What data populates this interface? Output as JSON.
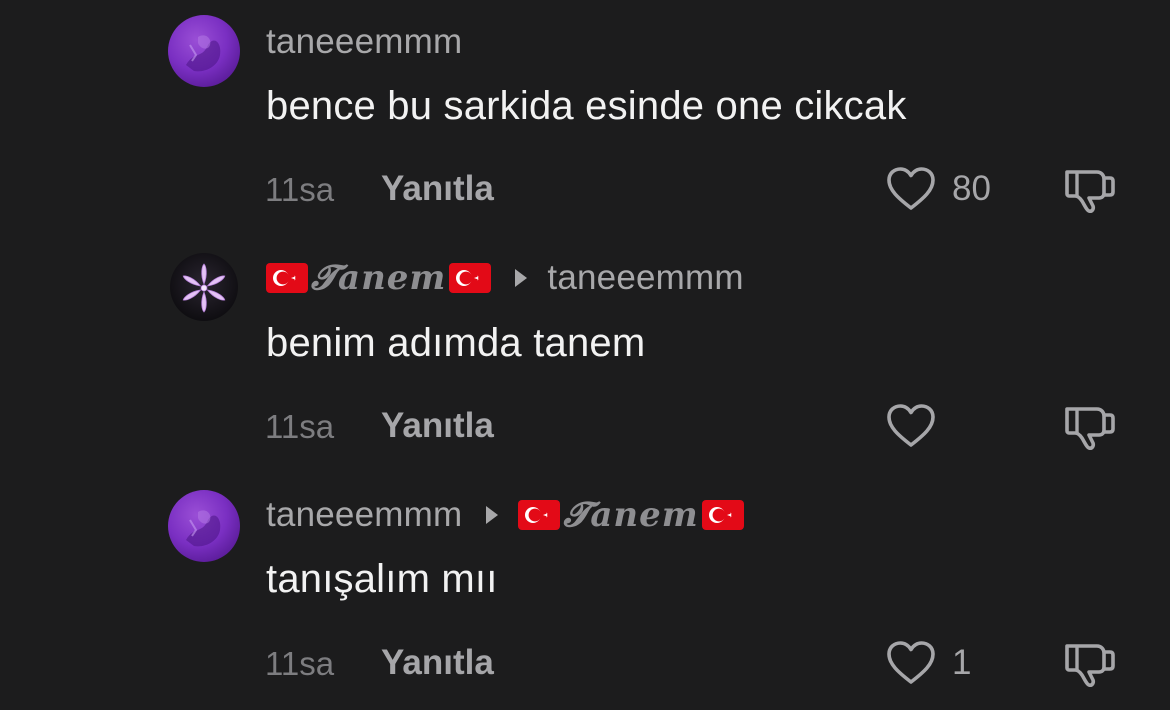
{
  "colors": {
    "background": "#1c1c1d",
    "text_primary": "#f2f2f2",
    "text_secondary": "#a8a8aa",
    "text_muted": "#7d7d80"
  },
  "comments": [
    {
      "author": "taneeemmm",
      "reply_to": null,
      "text": "bence bu sarkida esinde one cikcak",
      "time": "11sa",
      "reply_label": "Yanıtla",
      "likes": "80",
      "avatar": "purple-avatar"
    },
    {
      "author": "𝓣anem",
      "author_flags": [
        "turkey-flag-icon",
        "turkey-flag-icon"
      ],
      "reply_to": "taneeemmm",
      "text": "benim adımda tanem",
      "time": "11sa",
      "reply_label": "Yanıtla",
      "likes": "",
      "avatar": "lily-flower-avatar"
    },
    {
      "author": "taneeemmm",
      "reply_to": "𝓣anem",
      "reply_to_flags": [
        "turkey-flag-icon",
        "turkey-flag-icon"
      ],
      "text": "tanışalım mıı",
      "time": "11sa",
      "reply_label": "Yanıtla",
      "likes": "1",
      "avatar": "purple-avatar"
    }
  ]
}
